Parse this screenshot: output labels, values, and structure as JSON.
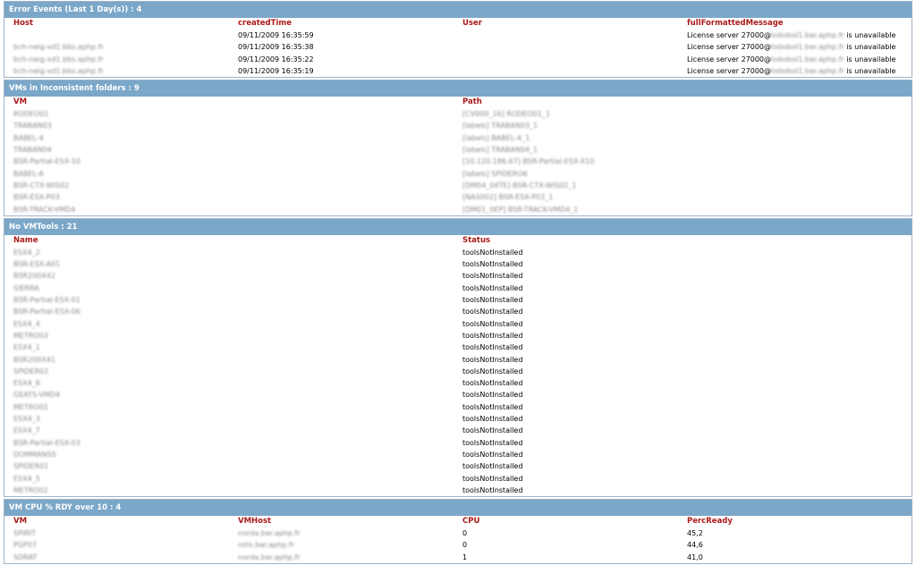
{
  "sections": {
    "errors": {
      "title": "Error Events (Last 1 Day(s)) : 4",
      "headers": [
        "Host",
        "createdTime",
        "User",
        "fullFormattedMessage"
      ],
      "rows": [
        {
          "host": "",
          "time": "09/11/2009 16:35:59",
          "user": "",
          "msg_pre": "License server 27000@",
          "msg_host": "tobobol1.bar.aphp.fr",
          "msg_post": " is unavailable"
        },
        {
          "host": "bch-neig-xd1.bbs.aphp.fr",
          "time": "09/11/2009 16:35:38",
          "user": "",
          "msg_pre": "License server 27000@",
          "msg_host": "tobobol1.bar.aphp.fr",
          "msg_post": " is unavailable"
        },
        {
          "host": "bch-neig-xd1.bbs.aphp.fr",
          "time": "09/11/2009 16:35:22",
          "user": "",
          "msg_pre": "License server 27000@",
          "msg_host": "tobobol1.bar.aphp.fr",
          "msg_post": " is unavailable"
        },
        {
          "host": "bch-neig-xd1.bbs.aphp.fr",
          "time": "09/11/2009 16:35:19",
          "user": "",
          "msg_pre": "License server 27000@",
          "msg_host": "tobobol1.bar.aphp.fr",
          "msg_post": " is unavailable"
        }
      ]
    },
    "inconsistent": {
      "title": "VMs in Inconsistent folders : 9",
      "headers": [
        "VM",
        "Path"
      ],
      "rows": [
        {
          "vm": "RODEO01",
          "path": "[CV000_16] RODEO01_1"
        },
        {
          "vm": "TRABAN03",
          "path": "[labels] TRABAN03_1"
        },
        {
          "vm": "BABEL-4",
          "path": "[labels] BABEL-4_1"
        },
        {
          "vm": "TRABAN04",
          "path": "[labels] TRABAN04_1"
        },
        {
          "vm": "BSR-Partial-ESX-10",
          "path": "[10.120.186.67] BSR-Partial-ESX-X10"
        },
        {
          "vm": "BABEL-6",
          "path": "[labels] SPIDERO6"
        },
        {
          "vm": "BSR-CTX-WIS02",
          "path": "[DM04_04TE] BSR-CTX-WIS02_1"
        },
        {
          "vm": "BSR-ESX-P03",
          "path": "[NAS002] BSR-ESX-P03_1"
        },
        {
          "vm": "BSR-TRACK-VMD4",
          "path": "[DM01_0EP] BSR-TRACK-VMD4_1"
        }
      ]
    },
    "novmtools": {
      "title": "No VMTools : 21",
      "headers": [
        "Name",
        "Status"
      ],
      "rows": [
        {
          "name": "ESX4_2",
          "status": "toolsNotInstalled"
        },
        {
          "name": "BSR-ESX-A01",
          "status": "toolsNotInstalled"
        },
        {
          "name": "BSR200X42",
          "status": "toolsNotInstalled"
        },
        {
          "name": "SIERRA",
          "status": "toolsNotInstalled"
        },
        {
          "name": "BSR-Partial-ESX-01",
          "status": "toolsNotInstalled"
        },
        {
          "name": "BSR-Partial-ESX-06",
          "status": "toolsNotInstalled"
        },
        {
          "name": "ESX4_4",
          "status": "toolsNotInstalled"
        },
        {
          "name": "METRO03",
          "status": "toolsNotInstalled"
        },
        {
          "name": "ESX4_1",
          "status": "toolsNotInstalled"
        },
        {
          "name": "BSR200X41",
          "status": "toolsNotInstalled"
        },
        {
          "name": "SPIDER02",
          "status": "toolsNotInstalled"
        },
        {
          "name": "ESX4_6",
          "status": "toolsNotInstalled"
        },
        {
          "name": "GEATS-VMD4",
          "status": "toolsNotInstalled"
        },
        {
          "name": "METRO01",
          "status": "toolsNotInstalled"
        },
        {
          "name": "ESX4_3",
          "status": "toolsNotInstalled"
        },
        {
          "name": "ESX4_7",
          "status": "toolsNotInstalled"
        },
        {
          "name": "BSR-Partial-ESX-03",
          "status": "toolsNotInstalled"
        },
        {
          "name": "DOMMANS5",
          "status": "toolsNotInstalled"
        },
        {
          "name": "SPIDER01",
          "status": "toolsNotInstalled"
        },
        {
          "name": "ESX4_5",
          "status": "toolsNotInstalled"
        },
        {
          "name": "METRO02",
          "status": "toolsNotInstalled"
        }
      ]
    },
    "cpu": {
      "title": "VM CPU % RDY over 10 : 4",
      "headers": [
        "VM",
        "VMHost",
        "CPU",
        "PercReady"
      ],
      "rows": [
        {
          "vm": "SPIRIT",
          "host": "norda.bar.aphp.fr",
          "cpu": "0",
          "ready": "45,2"
        },
        {
          "vm": "PGP07",
          "host": "rolls.bar.aphp.fr",
          "cpu": "0",
          "ready": "44,6"
        },
        {
          "vm": "SDRAT",
          "host": "norda.bar.aphp.fr",
          "cpu": "1",
          "ready": "41,0"
        }
      ]
    }
  }
}
